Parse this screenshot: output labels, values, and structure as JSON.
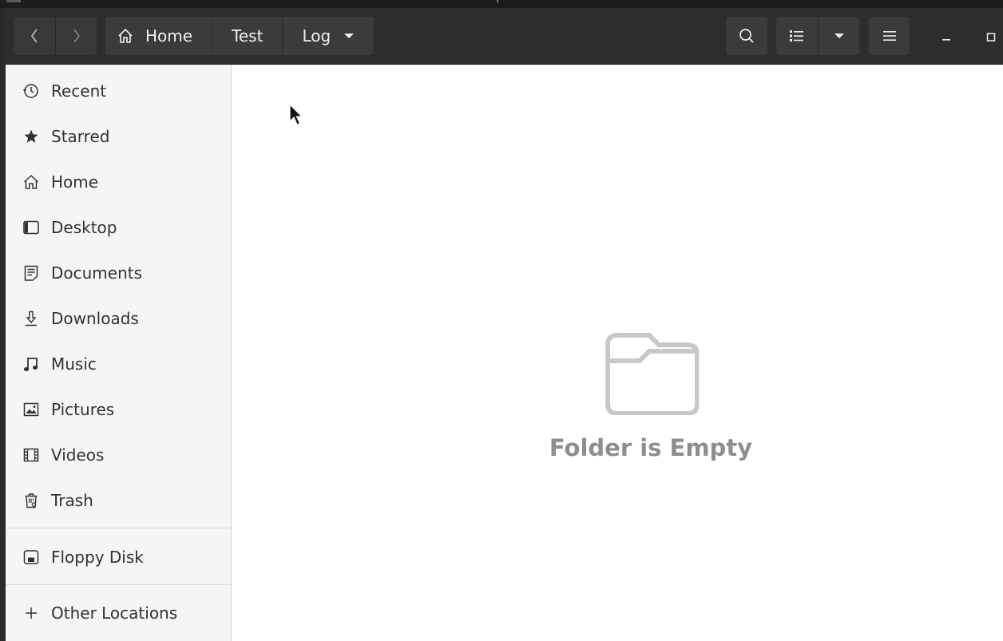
{
  "navigation": {
    "back_icon": "chevron-left-icon",
    "forward_icon": "chevron-right-icon"
  },
  "path_bar": {
    "crumbs": [
      {
        "label": "Home",
        "icon": "home-icon"
      },
      {
        "label": "Test"
      },
      {
        "label": "Log",
        "icon": "caret-down-icon"
      }
    ]
  },
  "toolbar": {
    "search_icon": "search-icon",
    "view_icon": "list-view-icon",
    "view_menu_icon": "caret-down-icon",
    "menu_icon": "hamburger-icon"
  },
  "window_controls": {
    "minimize_icon": "minimize-icon",
    "maximize_icon": "maximize-icon"
  },
  "sidebar": {
    "items": [
      {
        "label": "Recent",
        "icon": "clock-icon"
      },
      {
        "label": "Starred",
        "icon": "star-icon"
      },
      {
        "label": "Home",
        "icon": "home-icon"
      },
      {
        "label": "Desktop",
        "icon": "desktop-icon"
      },
      {
        "label": "Documents",
        "icon": "document-icon"
      },
      {
        "label": "Downloads",
        "icon": "download-icon"
      },
      {
        "label": "Music",
        "icon": "music-icon"
      },
      {
        "label": "Pictures",
        "icon": "picture-icon"
      },
      {
        "label": "Videos",
        "icon": "video-icon"
      },
      {
        "label": "Trash",
        "icon": "trash-icon"
      }
    ],
    "devices": [
      {
        "label": "Floppy Disk",
        "icon": "floppy-disk-icon"
      }
    ],
    "other": [
      {
        "label": "Other Locations",
        "icon": "plus-icon"
      }
    ]
  },
  "content": {
    "empty_message": "Folder is Empty",
    "empty_icon": "folder-icon"
  },
  "colors": {
    "headerbar": "#2d2d2d",
    "button": "#3b3b3b",
    "sidebar": "#f6f5f4",
    "content": "#ffffff",
    "empty_text": "#8e8e8e"
  }
}
